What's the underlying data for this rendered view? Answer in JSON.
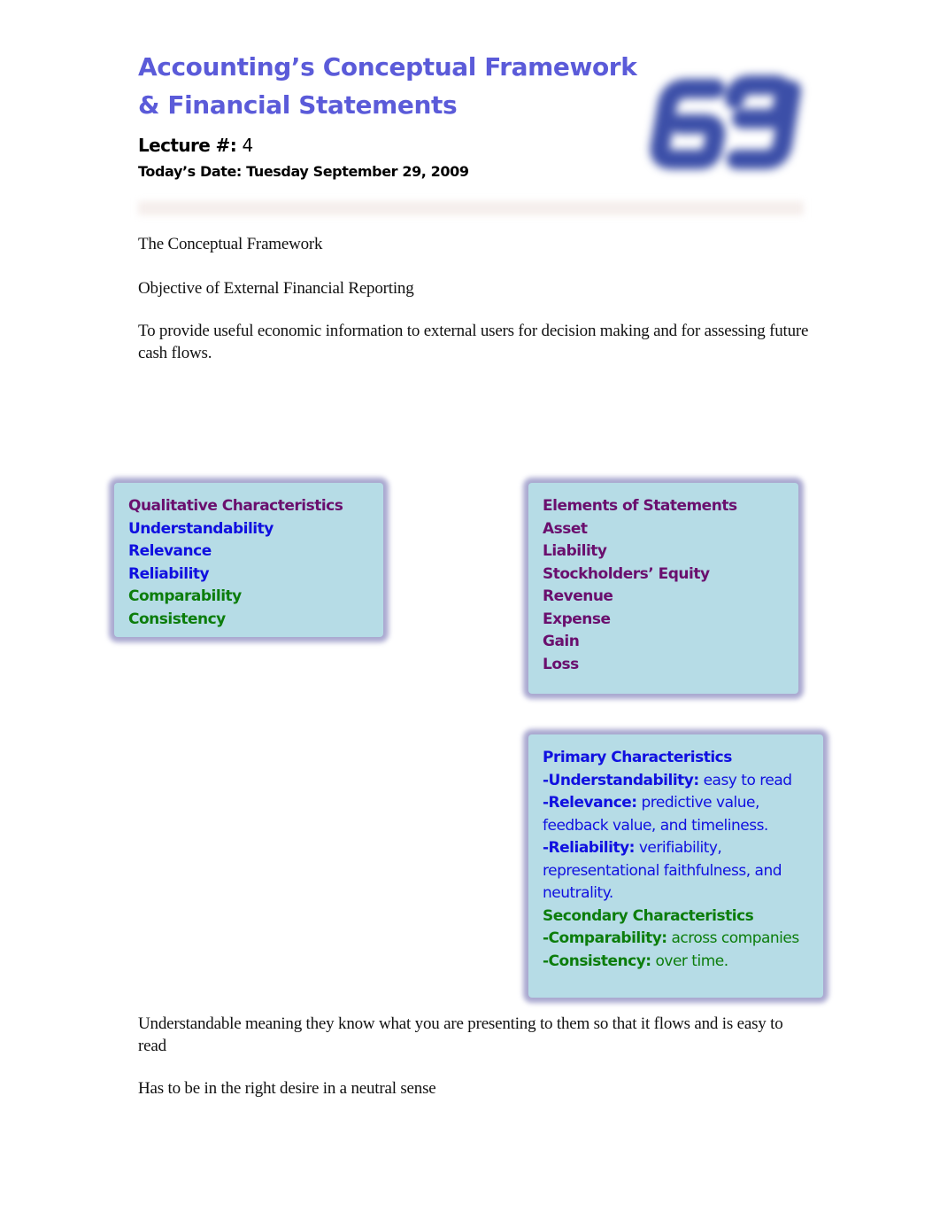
{
  "header": {
    "title_line1": "Accounting’s Conceptual Framework",
    "title_line2": "& Financial Statements",
    "lecture_label": "Lecture #:",
    "lecture_number": "4",
    "date_label": "Today’s Date:",
    "date_value": "Tuesday September 29, 2009",
    "logo_icon": "blurred-69-logo"
  },
  "body": {
    "heading": "The Conceptual Framework",
    "objective_heading": "Objective of External Financial Reporting",
    "objective_text": "To provide useful economic information to external users for decision making and for assessing future cash flows.",
    "note1": "Understandable meaning they know what you are presenting to them so that it flows and is easy to read",
    "note2": "Has to be in the right desire in a neutral sense"
  },
  "qualitative_box": {
    "title": "Qualitative Characteristics",
    "items": [
      {
        "label": "Understandability",
        "color": "#1010e0"
      },
      {
        "label": "Relevance",
        "color": "#1010e0"
      },
      {
        "label": "Reliability",
        "color": "#1010e0"
      },
      {
        "label": "Comparability",
        "color": "#0c7d0c"
      },
      {
        "label": "Consistency",
        "color": "#0c7d0c"
      }
    ]
  },
  "elements_box": {
    "title": "Elements of Statements",
    "items": [
      "Asset",
      "Liability",
      "Stockholders’ Equity",
      "Revenue",
      "Expense",
      "Gain",
      "Loss"
    ]
  },
  "characteristics_box": {
    "primary_title": "Primary Characteristics",
    "primary": [
      {
        "term": "-Understandability:",
        "desc": " easy to read"
      },
      {
        "term": "-Relevance:",
        "desc": " predictive value,",
        "cont": "feedback value, and timeliness."
      },
      {
        "term": "-Reliability:",
        "desc": " verifiability,",
        "cont": "representational faithfulness, and",
        "cont2": "neutrality."
      }
    ],
    "secondary_title": "Secondary Characteristics",
    "secondary": [
      {
        "term": "-Comparability:",
        "desc": " across companies"
      },
      {
        "term": "-Consistency:",
        "desc": " over time."
      }
    ]
  },
  "colors": {
    "title": "#5b5bd9",
    "purple": "#6a0f6e",
    "blue": "#1010e0",
    "green": "#0c7d0c",
    "box_fill": "#b6dce6",
    "box_border": "#a9a8d0"
  }
}
